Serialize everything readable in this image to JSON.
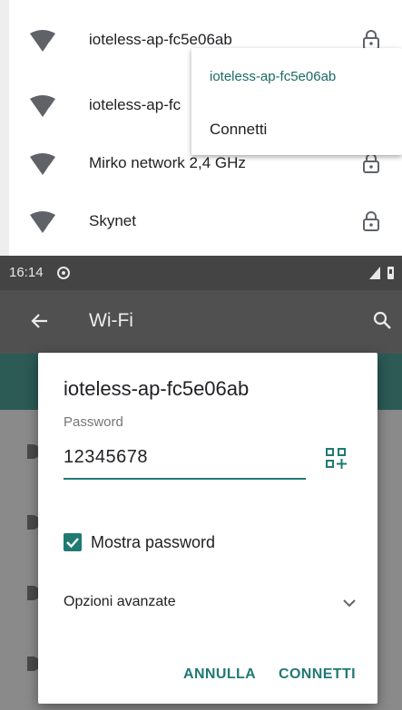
{
  "wifi_list": {
    "networks": [
      {
        "ssid": "ioteless-ap-fc5e06ab",
        "signal_badge": "4",
        "secured": true
      },
      {
        "ssid": "ioteless-ap-fc",
        "signal_badge": "4",
        "secured": true
      },
      {
        "ssid": "Mirko network 2,4 GHz",
        "signal_badge": "4",
        "secured": true
      },
      {
        "ssid": "Skynet",
        "signal_badge": "4",
        "secured": true
      }
    ],
    "context_menu": {
      "ssid": "ioteless-ap-fc5e06ab",
      "connect_label": "Connetti"
    }
  },
  "status_bar": {
    "time": "16:14"
  },
  "app_bar": {
    "title": "Wi-Fi",
    "back_icon": "arrow-back-icon",
    "search_icon": "search-icon"
  },
  "dialog": {
    "title": "ioteless-ap-fc5e06ab",
    "password_label": "Password",
    "password_value": "12345678",
    "show_password_label": "Mostra password",
    "show_password_checked": true,
    "advanced_options_label": "Opzioni avanzate",
    "cancel_label": "ANNULLA",
    "connect_label": "CONNETTI"
  },
  "colors": {
    "accent": "#1f7a73",
    "menu_accent": "#1a6a66",
    "scrim": "#7a7a7a"
  }
}
